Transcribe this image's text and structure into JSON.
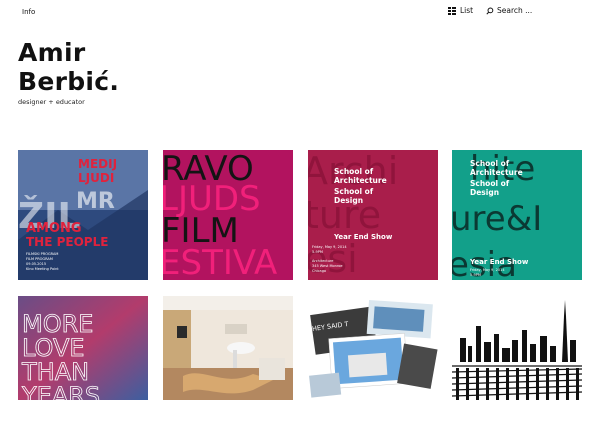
{
  "nav": {
    "info_label": "Info",
    "list_label": "List",
    "search_label": "Search ..."
  },
  "site": {
    "title_line1": "Amir",
    "title_line2": "Berbić.",
    "tagline": "designer + educator"
  },
  "tiles": [
    {
      "name": "medij-poster",
      "lines": [
        "MEDIJ",
        "LJUDI",
        "ŽIL",
        "MR",
        "AMONG",
        "THE PEOPLE"
      ],
      "caption": [
        "FILMSKI PROGRAM",
        "FILM PROGRAM",
        "09.05.2015",
        "Kino Meeting Point"
      ]
    },
    {
      "name": "ravo-festival",
      "lines": [
        "RAVO",
        "LJUDS",
        "FILM",
        "ESTIVA"
      ]
    },
    {
      "name": "school-architecture-pink",
      "lines": [
        "School of",
        "Architecture",
        "School of",
        "Design",
        "Year End Show"
      ],
      "caption": [
        "Friday, May 9, 2014",
        "5-9PM",
        "Architecture",
        "345 West Monroe",
        "Chicago"
      ]
    },
    {
      "name": "school-architecture-teal",
      "lines": [
        "School of",
        "Architecture",
        "School of",
        "Design",
        "Year End Show"
      ],
      "caption": [
        "Friday, May 9, 2014",
        "5-9PM"
      ]
    },
    {
      "name": "more-love-than-years",
      "lines": [
        "MORE",
        "LOVE",
        "THAN",
        "YEARS"
      ]
    },
    {
      "name": "interior-installation"
    },
    {
      "name": "postcards-collage",
      "lines": [
        "HEY SAID T"
      ]
    },
    {
      "name": "skyline-illustration"
    }
  ]
}
